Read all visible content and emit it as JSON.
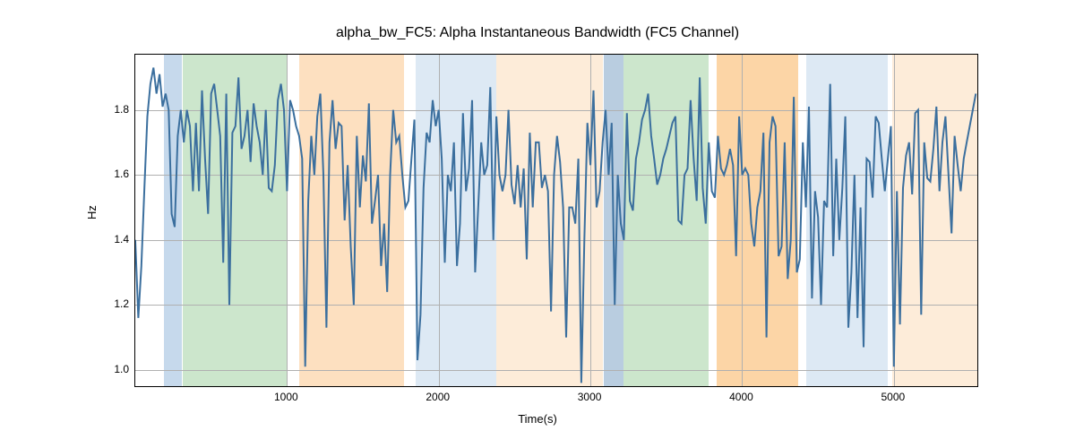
{
  "chart_data": {
    "type": "line",
    "title": "alpha_bw_FC5: Alpha Instantaneous Bandwidth (FC5 Channel)",
    "xlabel": "Time(s)",
    "ylabel": "Hz",
    "xlim": [
      0,
      5550
    ],
    "ylim": [
      0.95,
      1.97
    ],
    "xticks": [
      1000,
      2000,
      3000,
      4000,
      5000
    ],
    "yticks": [
      1.0,
      1.2,
      1.4,
      1.6,
      1.8
    ],
    "regions": [
      {
        "x0": 190,
        "x1": 310,
        "color": "#c6d9ec"
      },
      {
        "x0": 310,
        "x1": 1000,
        "color": "#cce6cc"
      },
      {
        "x0": 1080,
        "x1": 1770,
        "color": "#fde0c0"
      },
      {
        "x0": 1850,
        "x1": 2380,
        "color": "#dde9f4"
      },
      {
        "x0": 2380,
        "x1": 3080,
        "color": "#fdecd9"
      },
      {
        "x0": 3090,
        "x1": 3220,
        "color": "#b9cde0"
      },
      {
        "x0": 3220,
        "x1": 3780,
        "color": "#cce6cc"
      },
      {
        "x0": 3830,
        "x1": 4370,
        "color": "#fcd5a6"
      },
      {
        "x0": 4420,
        "x1": 4960,
        "color": "#dde9f4"
      },
      {
        "x0": 4990,
        "x1": 5550,
        "color": "#fdecd9"
      }
    ],
    "series": [
      {
        "name": "alpha_bw_FC5",
        "color": "#3b6f9e",
        "x_step": 20,
        "values": [
          1.4,
          1.16,
          1.32,
          1.56,
          1.78,
          1.88,
          1.93,
          1.85,
          1.91,
          1.81,
          1.85,
          1.8,
          1.48,
          1.44,
          1.72,
          1.8,
          1.7,
          1.8,
          1.75,
          1.55,
          1.76,
          1.55,
          1.86,
          1.65,
          1.48,
          1.85,
          1.88,
          1.8,
          1.72,
          1.33,
          1.85,
          1.2,
          1.73,
          1.75,
          1.9,
          1.68,
          1.72,
          1.8,
          1.64,
          1.82,
          1.75,
          1.7,
          1.6,
          1.8,
          1.56,
          1.55,
          1.63,
          1.83,
          1.88,
          1.8,
          1.55,
          1.83,
          1.8,
          1.75,
          1.72,
          1.65,
          1.01,
          1.52,
          1.72,
          1.6,
          1.78,
          1.85,
          1.6,
          1.13,
          1.7,
          1.83,
          1.68,
          1.76,
          1.75,
          1.46,
          1.63,
          1.38,
          1.2,
          1.72,
          1.5,
          1.66,
          1.58,
          1.82,
          1.45,
          1.52,
          1.6,
          1.32,
          1.45,
          1.24,
          1.6,
          1.8,
          1.7,
          1.72,
          1.6,
          1.5,
          1.52,
          1.65,
          1.77,
          1.03,
          1.17,
          1.56,
          1.73,
          1.7,
          1.83,
          1.75,
          1.8,
          1.65,
          1.33,
          1.6,
          1.55,
          1.7,
          1.32,
          1.45,
          1.79,
          1.55,
          1.62,
          1.83,
          1.3,
          1.5,
          1.7,
          1.6,
          1.63,
          1.87,
          1.4,
          1.78,
          1.6,
          1.55,
          1.6,
          1.8,
          1.57,
          1.51,
          1.63,
          1.5,
          1.62,
          1.34,
          1.73,
          1.5,
          1.7,
          1.7,
          1.56,
          1.6,
          1.55,
          1.18,
          1.6,
          1.72,
          1.64,
          1.5,
          1.1,
          1.5,
          1.5,
          1.45,
          1.65,
          0.96,
          1.4,
          1.76,
          1.63,
          1.86,
          1.5,
          1.55,
          1.7,
          1.8,
          1.6,
          1.76,
          1.2,
          1.6,
          1.45,
          1.4,
          1.79,
          1.52,
          1.49,
          1.65,
          1.7,
          1.77,
          1.8,
          1.85,
          1.72,
          1.65,
          1.57,
          1.6,
          1.65,
          1.68,
          1.72,
          1.76,
          1.78,
          1.46,
          1.45,
          1.6,
          1.62,
          1.83,
          1.65,
          1.52,
          1.9,
          1.56,
          1.45,
          1.7,
          1.55,
          1.53,
          1.72,
          1.62,
          1.6,
          1.63,
          1.68,
          1.63,
          1.35,
          1.78,
          1.6,
          1.62,
          1.6,
          1.45,
          1.38,
          1.5,
          1.55,
          1.73,
          1.1,
          1.7,
          1.78,
          1.75,
          1.35,
          1.38,
          1.7,
          1.28,
          1.4,
          1.84,
          1.3,
          1.34,
          1.7,
          1.5,
          1.81,
          1.22,
          1.55,
          1.47,
          1.2,
          1.52,
          1.5,
          1.88,
          1.35,
          1.65,
          1.4,
          1.56,
          1.78,
          1.13,
          1.3,
          1.6,
          1.16,
          1.5,
          1.07,
          1.65,
          1.64,
          1.53,
          1.78,
          1.76,
          1.65,
          1.55,
          1.65,
          1.75,
          1.01,
          1.55,
          1.14,
          1.56,
          1.66,
          1.7,
          1.54,
          1.79,
          1.8,
          1.17,
          1.7,
          1.59,
          1.58,
          1.68,
          1.81,
          1.55,
          1.7,
          1.78,
          1.6,
          1.42,
          1.72,
          1.63,
          1.55,
          1.65,
          1.7,
          1.75,
          1.8,
          1.85
        ]
      }
    ]
  }
}
